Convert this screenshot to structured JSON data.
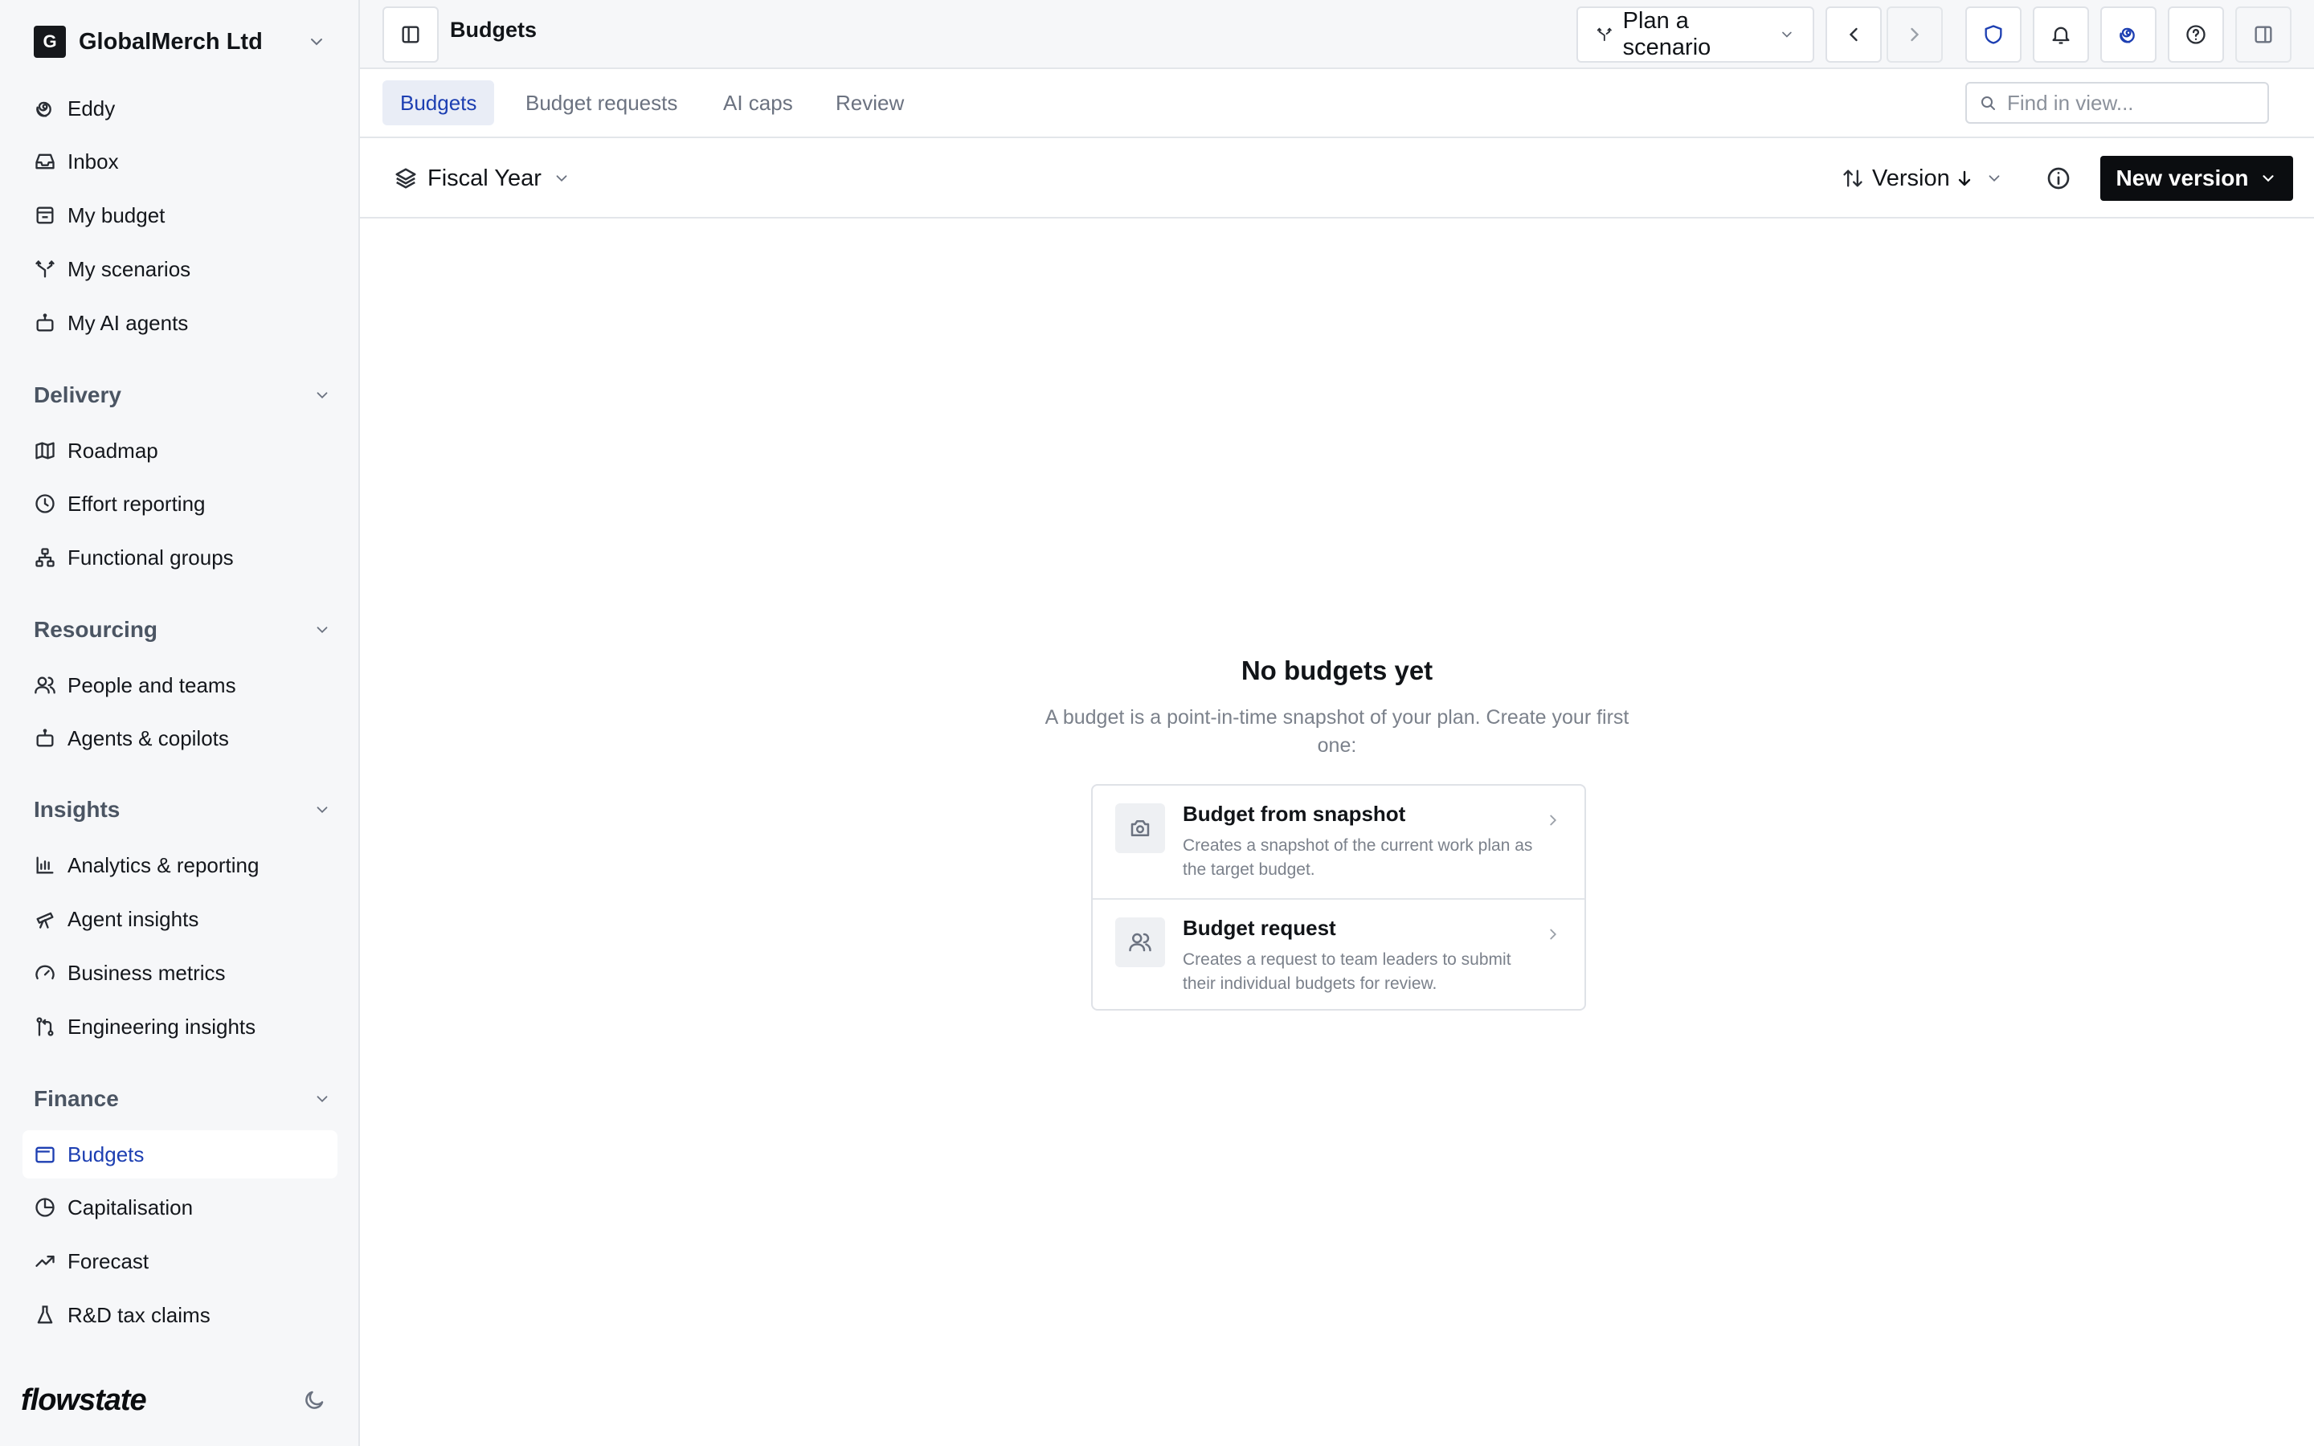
{
  "org": {
    "initial": "G",
    "name": "GlobalMerch Ltd"
  },
  "sidebar": {
    "top_items": [
      {
        "label": "Eddy",
        "icon": "eddy-swirl-icon"
      },
      {
        "label": "Inbox",
        "icon": "inbox-icon"
      },
      {
        "label": "My budget",
        "icon": "budget-icon"
      },
      {
        "label": "My scenarios",
        "icon": "branch-icon"
      },
      {
        "label": "My AI agents",
        "icon": "robot-icon"
      }
    ],
    "sections": [
      {
        "title": "Delivery",
        "items": [
          {
            "label": "Roadmap",
            "icon": "map-icon"
          },
          {
            "label": "Effort reporting",
            "icon": "clock-icon"
          },
          {
            "label": "Functional groups",
            "icon": "org-chart-icon"
          }
        ]
      },
      {
        "title": "Resourcing",
        "items": [
          {
            "label": "People and teams",
            "icon": "users-icon"
          },
          {
            "label": "Agents & copilots",
            "icon": "robot-icon"
          }
        ]
      },
      {
        "title": "Insights",
        "items": [
          {
            "label": "Analytics & reporting",
            "icon": "bar-chart-icon"
          },
          {
            "label": "Agent insights",
            "icon": "telescope-icon"
          },
          {
            "label": "Business metrics",
            "icon": "gauge-icon"
          },
          {
            "label": "Engineering insights",
            "icon": "git-icon"
          }
        ]
      },
      {
        "title": "Finance",
        "items": [
          {
            "label": "Budgets",
            "icon": "wallet-icon",
            "active": true
          },
          {
            "label": "Capitalisation",
            "icon": "pie-chart-icon"
          },
          {
            "label": "Forecast",
            "icon": "trend-icon"
          },
          {
            "label": "R&D tax claims",
            "icon": "flask-icon"
          }
        ]
      }
    ],
    "brand": "flowstate"
  },
  "header": {
    "title": "Budgets",
    "scenario_label": "Plan a scenario"
  },
  "tabs": [
    {
      "label": "Budgets",
      "active": true
    },
    {
      "label": "Budget requests"
    },
    {
      "label": "AI caps"
    },
    {
      "label": "Review"
    }
  ],
  "search": {
    "placeholder": "Find in view..."
  },
  "toolbar": {
    "group_label": "Fiscal Year",
    "sort_label": "Version",
    "new_version_label": "New version"
  },
  "empty_state": {
    "title": "No budgets yet",
    "description": "A budget is a point-in-time snapshot of your plan. Create your first one:",
    "options": [
      {
        "title": "Budget from snapshot",
        "description": "Creates a snapshot of the current work plan as the target budget.",
        "icon": "camera-icon"
      },
      {
        "title": "Budget request",
        "description": "Creates a request to team leaders to submit their individual budgets for review.",
        "icon": "users-icon"
      }
    ]
  },
  "colors": {
    "accent": "#1d3fb2",
    "sidebar_bg": "#f6f7f9",
    "primary_button": "#0b0d10"
  }
}
